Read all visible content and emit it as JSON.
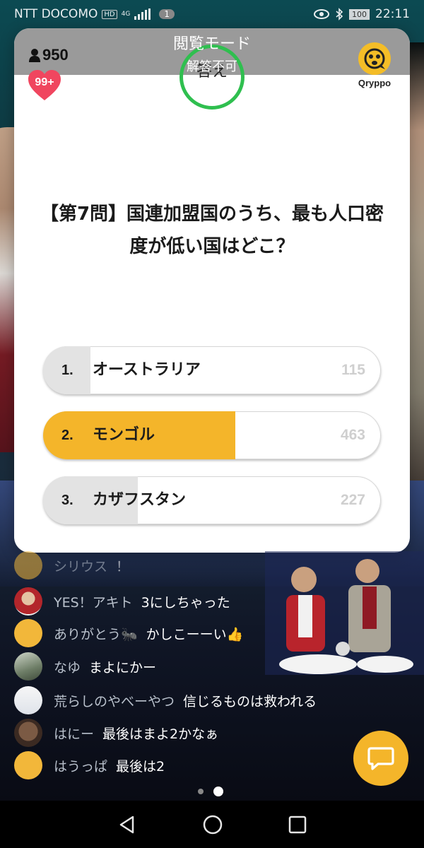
{
  "status_bar": {
    "carrier": "NTT DOCOMO",
    "hd_badge": "HD",
    "network": "4G",
    "notification_count": "1",
    "battery": "100",
    "time": "22:11"
  },
  "header": {
    "mode_title": "閲覧モード",
    "mode_subtitle": "解答不可",
    "timer_label": "答え",
    "viewer_count": "950",
    "hearts_badge": "99+",
    "brand_name": "Qryppo"
  },
  "question": {
    "text": "【第7問】国連加盟国のうち、最も人口密度が低い国はどこ？"
  },
  "options": [
    {
      "number": "1.",
      "label": "オーストラリア",
      "count": "115",
      "fill_ratio": 0.14,
      "highlight": false
    },
    {
      "number": "2.",
      "label": "モンゴル",
      "count": "463",
      "fill_ratio": 0.57,
      "highlight": true
    },
    {
      "number": "3.",
      "label": "カザフスタン",
      "count": "227",
      "fill_ratio": 0.28,
      "highlight": false
    }
  ],
  "colors": {
    "accent_yellow": "#f4b52a",
    "timer_green": "#2fbf4f",
    "bar_gray": "#e3e3e3",
    "heart_pink": "#f0465f"
  },
  "chat": [
    {
      "name": "シリウス",
      "message": "！"
    },
    {
      "name": "YES！アキト",
      "message": "3にしちゃった"
    },
    {
      "name": "ありがとう🐜",
      "message": "かしこーーい👍"
    },
    {
      "name": "なゆ",
      "message": "まよにかー"
    },
    {
      "name": "荒らしのやべーやつ",
      "message": "信じるものは救われる"
    },
    {
      "name": "はにー",
      "message": "最後はまよ2かなぁ"
    },
    {
      "name": "はうっぱ",
      "message": "最後は2"
    }
  ],
  "pager": {
    "pages": 2,
    "current": 2
  }
}
